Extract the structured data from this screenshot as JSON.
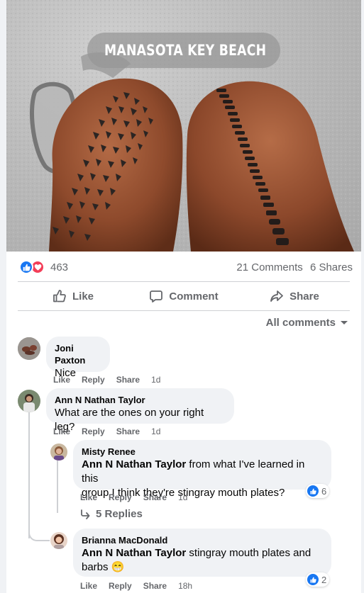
{
  "post": {
    "location_label": "MANASOTA KEY BEACH",
    "reaction_count": "463",
    "comments_count": "21 Comments",
    "shares_count": "6 Shares"
  },
  "actions": {
    "like": "Like",
    "comment": "Comment",
    "share": "Share"
  },
  "sort_label": "All comments",
  "comments": [
    {
      "author": "Joni Paxton",
      "text": "Nice",
      "like": "Like",
      "reply": "Reply",
      "share": "Share",
      "time": "1d"
    },
    {
      "author": "Ann N Nathan Taylor",
      "text": "What are the ones on your right leg?",
      "like": "Like",
      "reply": "Reply",
      "share": "Share",
      "time": "1d",
      "replies": [
        {
          "author": "Misty Renee",
          "mention": "Ann N Nathan Taylor",
          "text_line1": " from what I've learned in this",
          "text_line2": "group I think they're stingray mouth plates?",
          "like": "Like",
          "reply": "Reply",
          "share": "Share",
          "time": "1d",
          "reactions": "6"
        },
        {
          "author": "Brianna MacDonald",
          "mention": "Ann N Nathan Taylor",
          "text_line1": " stingray mouth plates and",
          "text_line2": "barbs",
          "emoji": "😁",
          "like": "Like",
          "reply": "Reply",
          "share": "Share",
          "time": "18h",
          "reactions": "2"
        }
      ],
      "more_replies": "5 Replies"
    }
  ],
  "icons": [
    "location-pin-icon",
    "like-reaction-icon",
    "love-reaction-icon",
    "thumbs-up-icon",
    "comment-icon",
    "share-icon",
    "chevron-down-icon",
    "reply-arrow-icon"
  ],
  "colors": {
    "accent": "#1877f2",
    "love": "#f33e58",
    "muted": "#65676b",
    "bubble": "#f0f2f5"
  }
}
